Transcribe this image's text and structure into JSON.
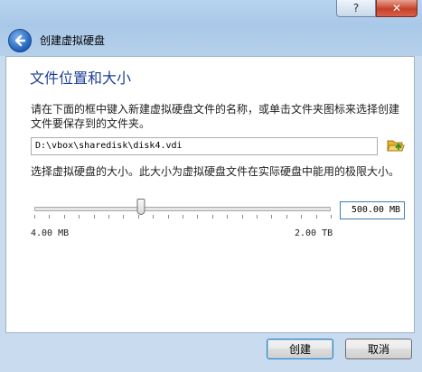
{
  "window": {
    "help_glyph": "?",
    "close_glyph": "✕",
    "title": "创建虚拟硬盘"
  },
  "page": {
    "heading": "文件位置和大小",
    "location_description": "请在下面的框中键入新建虚拟硬盘文件的名称，或单击文件夹图标来选择创建文件要保存到的文件夹。",
    "file_path": "D:\\vbox\\sharedisk\\disk4.vdi",
    "size_description": "选择虚拟硬盘的大小。此大小为虚拟硬盘文件在实际硬盘中能用的极限大小。",
    "size_value": "500.00 MB",
    "size_min_label": "4.00 MB",
    "size_max_label": "2.00 TB",
    "slider_level_percent": 36
  },
  "buttons": {
    "create": "创建",
    "cancel": "取消"
  },
  "icons": {
    "back": "back-arrow-icon",
    "folder": "folder-open-icon"
  },
  "colors": {
    "heading": "#1c3f95",
    "chrome": "#b8d3ef",
    "folder": "#e8b43a",
    "folder_arrow": "#2f8a1e"
  }
}
